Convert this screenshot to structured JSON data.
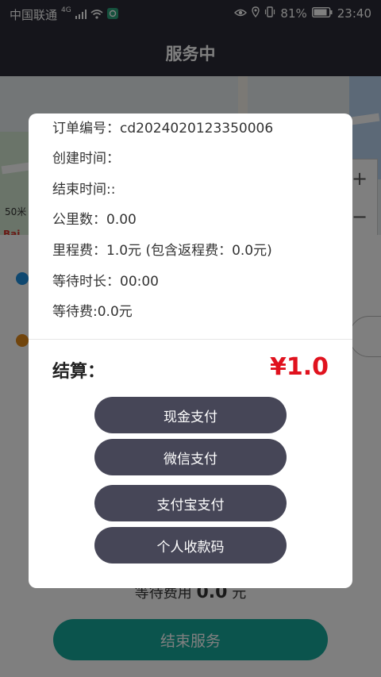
{
  "statusbar": {
    "carrier": "中国联通",
    "network": "4G",
    "battery": "81%",
    "time": "23:40"
  },
  "header": {
    "title": "服务中"
  },
  "map": {
    "scale_label": "50米",
    "logo": "Bai"
  },
  "behind": {
    "wait_fee_label": "等待费用",
    "wait_fee_value": "0.0",
    "wait_fee_unit": "元",
    "end_service_label": "结束服务"
  },
  "dialog": {
    "rows": [
      "订单编号：cd2024020123350006",
      "创建时间：",
      "结束时间::",
      "公里数：0.00",
      "里程费：1.0元 (包含返程费：0.0元)",
      "等待时长：00:00",
      "等待费:0.0元"
    ],
    "settle_label": "结算：",
    "settle_amount": "¥1.0",
    "buttons": [
      "现金支付",
      "微信支付",
      "支付宝支付",
      "个人收款码"
    ]
  },
  "colors": {
    "bar_bg": "#2b2b36",
    "amount_red": "#e0121e",
    "pay_button_bg": "#464657",
    "end_button_bg": "#17a99b"
  }
}
